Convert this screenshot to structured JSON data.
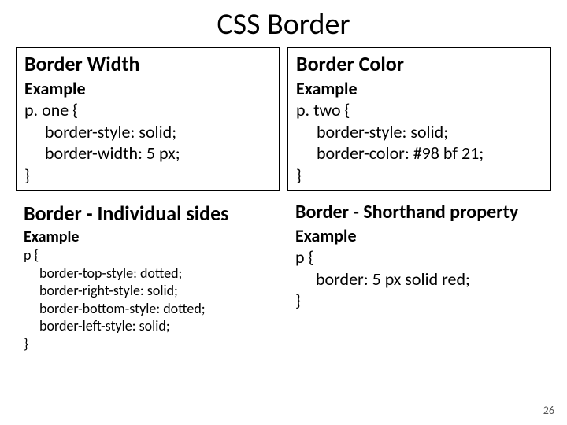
{
  "title": "CSS Border",
  "page_number": "26",
  "cells": {
    "tl": {
      "heading": "Border Width",
      "example_label": "Example",
      "sel": "p. one {",
      "l1": "border-style: solid;",
      "l2": "border-width: 5 px;",
      "close": "}"
    },
    "tr": {
      "heading": "Border Color",
      "example_label": "Example",
      "sel": "p. two {",
      "l1": "border-style: solid;",
      "l2": "border-color: #98 bf 21;",
      "close": "}"
    },
    "bl": {
      "heading": "Border - Individual sides",
      "example_label": "Example",
      "sel": "p {",
      "l1": "border-top-style: dotted;",
      "l2": "border-right-style: solid;",
      "l3": "border-bottom-style: dotted;",
      "l4": "border-left-style: solid;",
      "close": "}"
    },
    "br": {
      "heading": "Border - Shorthand property",
      "example_label": "Example",
      "sel": "p {",
      "l1": "border: 5 px solid red;",
      "close": "}"
    }
  }
}
